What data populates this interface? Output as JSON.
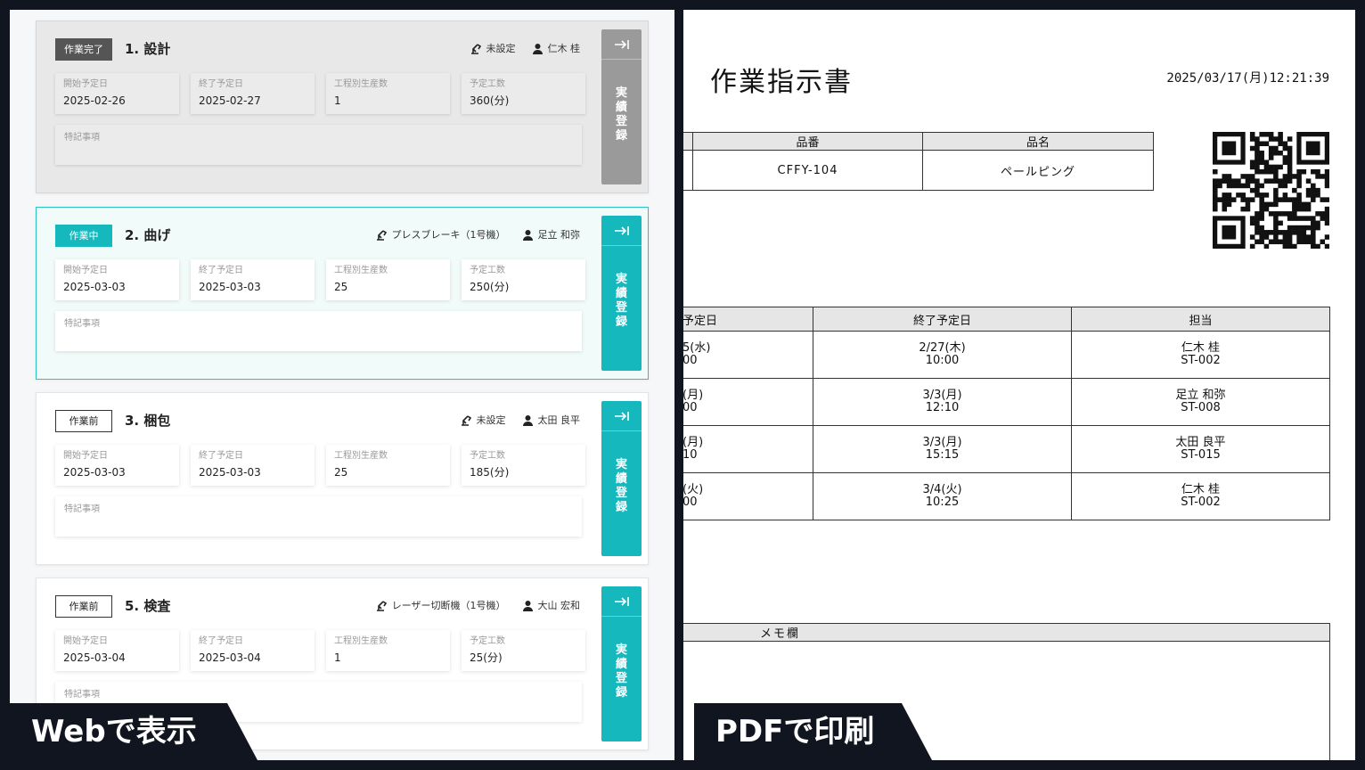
{
  "labels": {
    "web": "Webで表示",
    "pdf": "PDFで印刷"
  },
  "colors": {
    "accent": "#14b8bd",
    "done_badge": "#555555",
    "done_button": "#9a9a9a"
  },
  "web": {
    "field_labels": {
      "start": "開始予定日",
      "end": "終了予定日",
      "qty": "工程別生産数",
      "hours": "予定工数",
      "memo": "特記事項"
    },
    "register_label": "実績登録",
    "cards": [
      {
        "status": "作業完了",
        "title": "1. 設計",
        "machine": "未設定",
        "worker": "仁木 桂",
        "start": "2025-02-26",
        "end": "2025-02-27",
        "qty": "1",
        "hours": "360(分)"
      },
      {
        "status": "作業中",
        "title": "2. 曲げ",
        "machine": "プレスブレーキ（1号機）",
        "worker": "足立 和弥",
        "start": "2025-03-03",
        "end": "2025-03-03",
        "qty": "25",
        "hours": "250(分)"
      },
      {
        "status": "作業前",
        "title": "3. 梱包",
        "machine": "未設定",
        "worker": "太田 良平",
        "start": "2025-03-03",
        "end": "2025-03-03",
        "qty": "25",
        "hours": "185(分)"
      },
      {
        "status": "作業前",
        "title": "5. 検査",
        "machine": "レーザー切断機（1号機）",
        "worker": "大山 宏和",
        "start": "2025-03-04",
        "end": "2025-03-04",
        "qty": "1",
        "hours": "25(分)"
      }
    ]
  },
  "pdf": {
    "title": "作業指示書",
    "datetime": "2025/03/17(月)12:21:39",
    "product_headers": {
      "part_no": "品番",
      "name": "品名"
    },
    "product": {
      "part_no": "CFFY-104",
      "name": "ペールピング"
    },
    "schedule_headers": {
      "start": "予定日",
      "end": "終了予定日",
      "owner": "担当"
    },
    "schedule_rows": [
      {
        "start_a": "5(水)",
        "start_b": "00",
        "end_a": "2/27(木)",
        "end_b": "10:00",
        "owner_a": "仁木 桂",
        "owner_b": "ST-002"
      },
      {
        "start_a": "(月)",
        "start_b": "00",
        "end_a": "3/3(月)",
        "end_b": "12:10",
        "owner_a": "足立 和弥",
        "owner_b": "ST-008"
      },
      {
        "start_a": "(月)",
        "start_b": "10",
        "end_a": "3/3(月)",
        "end_b": "15:15",
        "owner_a": "太田 良平",
        "owner_b": "ST-015"
      },
      {
        "start_a": "(火)",
        "start_b": "00",
        "end_a": "3/4(火)",
        "end_b": "10:25",
        "owner_a": "仁木 桂",
        "owner_b": "ST-002"
      }
    ],
    "memo_header": "メモ欄"
  }
}
